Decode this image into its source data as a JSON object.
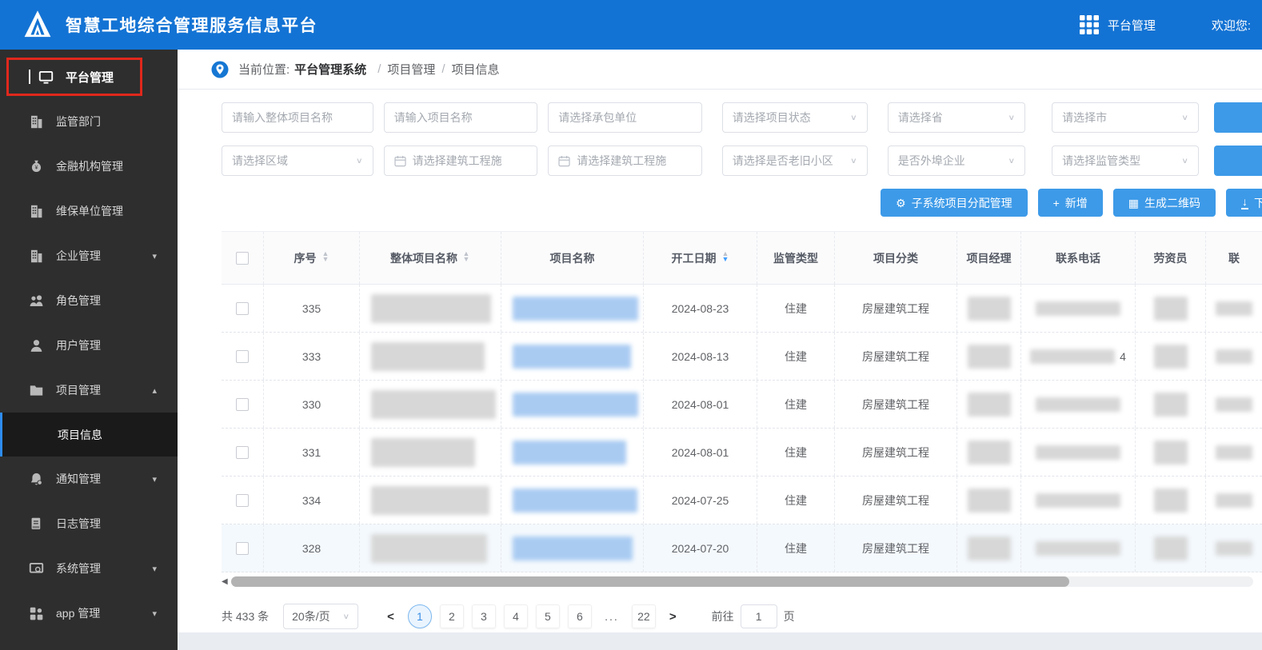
{
  "header": {
    "title": "智慧工地综合管理服务信息平台",
    "nav_label": "平台管理",
    "welcome": "欢迎您:"
  },
  "colors": {
    "header_bg": "#1373d4",
    "sidebar_bg": "#2e2e2e",
    "accent_blue": "#3d9ae8",
    "annotation_red": "#e0281c",
    "active_page_blue": "#3a8ee6"
  },
  "sidebar": {
    "items": [
      {
        "label": "平台管理",
        "icon": "monitor",
        "top": true,
        "highlighted": true
      },
      {
        "label": "监管部门",
        "icon": "building"
      },
      {
        "label": "金融机构管理",
        "icon": "moneybag"
      },
      {
        "label": "维保单位管理",
        "icon": "building"
      },
      {
        "label": "企业管理",
        "icon": "building",
        "arrow": "down"
      },
      {
        "label": "角色管理",
        "icon": "people"
      },
      {
        "label": "用户管理",
        "icon": "user"
      },
      {
        "label": "项目管理",
        "icon": "folder",
        "arrow": "up"
      },
      {
        "label": "项目信息",
        "sub": true,
        "active": true
      },
      {
        "label": "通知管理",
        "icon": "bell",
        "arrow": "down"
      },
      {
        "label": "日志管理",
        "icon": "doc",
        "arrow": null
      },
      {
        "label": "系统管理",
        "icon": "system",
        "arrow": "down"
      },
      {
        "label": "app 管理",
        "icon": "grid",
        "arrow": "down"
      }
    ]
  },
  "breadcrumb": {
    "prefix": "当前位置:",
    "root": "平台管理系统",
    "separator": "/",
    "crumbs": [
      "项目管理",
      "项目信息"
    ]
  },
  "filters": {
    "rows": [
      [
        {
          "type": "input",
          "placeholder": "请输入整体项目名称",
          "name": "overall-project-name-input"
        },
        {
          "type": "input",
          "placeholder": "请输入项目名称",
          "name": "project-name-input"
        },
        {
          "type": "input",
          "placeholder": "请选择承包单位",
          "name": "contractor-select"
        },
        {
          "type": "select",
          "placeholder": "请选择项目状态",
          "name": "project-status-select"
        },
        {
          "type": "select",
          "placeholder": "请选择省",
          "name": "province-select"
        },
        {
          "type": "select",
          "placeholder": "请选择市",
          "name": "city-select"
        }
      ],
      [
        {
          "type": "select",
          "placeholder": "请选择区域",
          "name": "region-select"
        },
        {
          "type": "date",
          "placeholder": "请选择建筑工程施",
          "name": "date-start-picker"
        },
        {
          "type": "date",
          "placeholder": "请选择建筑工程施",
          "name": "date-end-picker"
        },
        {
          "type": "select",
          "placeholder": "请选择是否老旧小区",
          "name": "old-community-select"
        },
        {
          "type": "select",
          "placeholder": "是否外埠企业",
          "name": "outside-enterprise-select"
        },
        {
          "type": "select",
          "placeholder": "请选择监管类型",
          "name": "supervision-type-select"
        }
      ]
    ]
  },
  "actions": [
    {
      "icon": "gear",
      "label": "子系统项目分配管理",
      "name": "subsystem-assign-button"
    },
    {
      "icon": "plus",
      "label": "新增",
      "name": "add-button"
    },
    {
      "icon": "qrcode",
      "label": "生成二维码",
      "name": "generate-qrcode-button"
    },
    {
      "icon": "download",
      "label": "下载",
      "name": "download-button"
    }
  ],
  "table": {
    "columns": [
      {
        "label": "",
        "key": "checkbox"
      },
      {
        "label": "序号",
        "key": "seq",
        "sort": "both"
      },
      {
        "label": "整体项目名称",
        "key": "overall",
        "sort": "both"
      },
      {
        "label": "项目名称",
        "key": "pname"
      },
      {
        "label": "开工日期",
        "key": "date",
        "sort": "desc"
      },
      {
        "label": "监管类型",
        "key": "sup"
      },
      {
        "label": "项目分类",
        "key": "cat"
      },
      {
        "label": "项目经理",
        "key": "mgr"
      },
      {
        "label": "联系电话",
        "key": "phone"
      },
      {
        "label": "劳资员",
        "key": "labor"
      },
      {
        "label": "联",
        "key": "cut"
      }
    ],
    "rows": [
      {
        "seq": "335",
        "start_date": "2024-08-23",
        "supervision": "住建",
        "category": "房屋建筑工程",
        "phone_suffix": ""
      },
      {
        "seq": "333",
        "start_date": "2024-08-13",
        "supervision": "住建",
        "category": "房屋建筑工程",
        "phone_suffix": "4"
      },
      {
        "seq": "330",
        "start_date": "2024-08-01",
        "supervision": "住建",
        "category": "房屋建筑工程",
        "phone_suffix": ""
      },
      {
        "seq": "331",
        "start_date": "2024-08-01",
        "supervision": "住建",
        "category": "房屋建筑工程",
        "phone_suffix": ""
      },
      {
        "seq": "334",
        "start_date": "2024-07-25",
        "supervision": "住建",
        "category": "房屋建筑工程",
        "phone_suffix": ""
      },
      {
        "seq": "328",
        "start_date": "2024-07-20",
        "supervision": "住建",
        "category": "房屋建筑工程",
        "phone_suffix": ""
      }
    ]
  },
  "pagination": {
    "total": "共 433 条",
    "page_size": "20条/页",
    "pages": [
      "1",
      "2",
      "3",
      "4",
      "5",
      "6",
      "...",
      "22"
    ],
    "current": "1",
    "goto_label": "前往",
    "goto_value": "1",
    "goto_suffix": "页"
  }
}
